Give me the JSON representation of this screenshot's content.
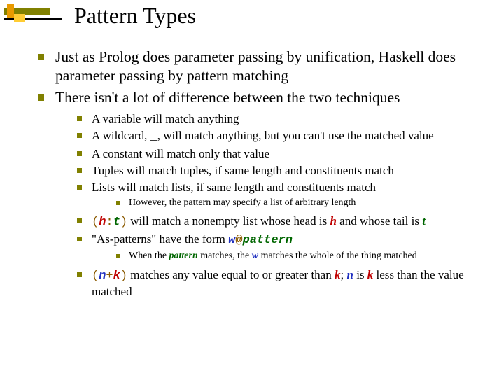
{
  "title": "Pattern Types",
  "b1": "Just as Prolog does parameter passing by unification, Haskell does parameter passing by pattern matching",
  "b2": "There isn't a lot of difference between the two techniques",
  "s1": "A variable will match anything",
  "s2a": "A wildcard, ",
  "s2u": "_",
  "s2b": ", will match anything, but you can't use the matched value",
  "s3": "A constant will match only that value",
  "s4": "Tuples will match tuples, if same length and constituents match",
  "s5": "Lists will match lists, if same length and constituents match",
  "t1": "However, the pattern may specify a list of arbitrary length",
  "p6_lp": "(",
  "p6_h": "h",
  "p6_colon": ":",
  "p6_t": "t",
  "p6_rp": ")",
  "p6_mid": " will match a nonempty list whose head is ",
  "p6_h2": "h",
  "p6_and": " and whose tail is ",
  "p6_t2": "t",
  "s7a": "\"As-patterns\" have the form ",
  "s7_w": "w",
  "s7_at": "@",
  "s7_pat": "pattern",
  "t2a": "When the ",
  "t2_pat": "pattern",
  "t2b": " matches, the ",
  "t2_w": "w",
  "t2c": " matches the whole of the thing matched",
  "p8_lp": "(",
  "p8_n": "n",
  "p8_plus": "+",
  "p8_k": "k",
  "p8_rp": ")",
  "p8_a": " matches any value equal to or greater than ",
  "p8_k2": "k",
  "p8_b": "; ",
  "p8_n2": "n",
  "p8_c": " is ",
  "p8_k3": "k",
  "p8_d": " less than the value matched"
}
